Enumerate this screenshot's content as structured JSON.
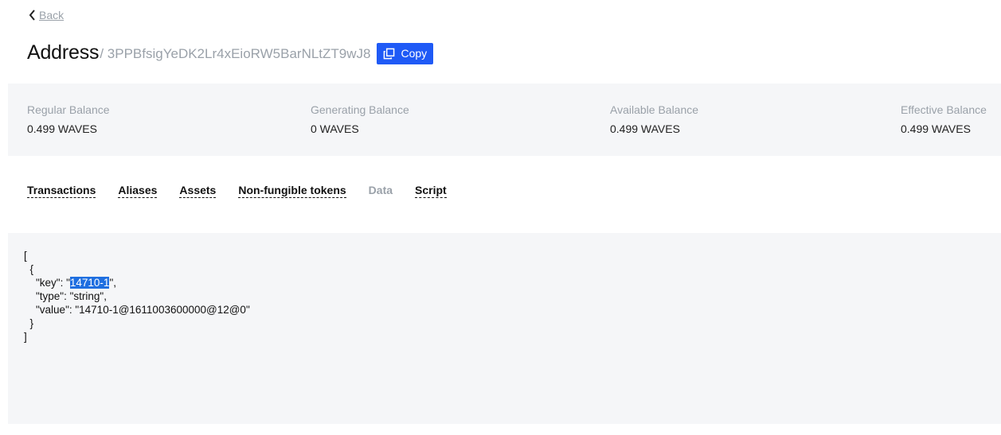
{
  "nav": {
    "back_label": "Back"
  },
  "header": {
    "title": "Address",
    "separator": "/",
    "address": "3PPBfsigYeDK2Lr4xEioRW5BarNLtZT9wJ8",
    "copy_label": "Copy"
  },
  "balances": [
    {
      "label": "Regular Balance",
      "value": "0.499 WAVES"
    },
    {
      "label": "Generating Balance",
      "value": "0 WAVES"
    },
    {
      "label": "Available Balance",
      "value": "0.499 WAVES"
    },
    {
      "label": "Effective Balance",
      "value": "0.499 WAVES"
    }
  ],
  "tabs": [
    {
      "label": "Transactions",
      "active": false
    },
    {
      "label": "Aliases",
      "active": false
    },
    {
      "label": "Assets",
      "active": false
    },
    {
      "label": "Non-fungible tokens",
      "active": false
    },
    {
      "label": "Data",
      "active": true
    },
    {
      "label": "Script",
      "active": false
    }
  ],
  "data_entries": [
    {
      "key": "14710-1",
      "type": "string",
      "value": "14710-1@1611003600000@12@0"
    }
  ],
  "selection": {
    "selected_text": "14710-1"
  },
  "colors": {
    "accent": "#1f5af6",
    "muted_text": "#9aa1a9",
    "panel_bg": "#f5f6f8",
    "selection_bg": "#1f6fe0"
  }
}
